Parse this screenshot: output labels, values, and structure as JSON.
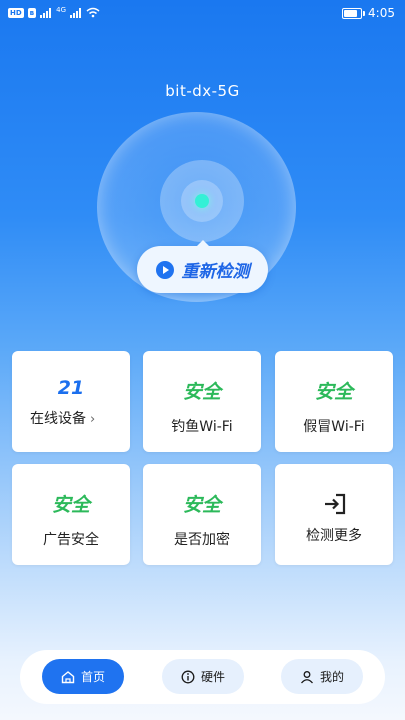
{
  "status_bar": {
    "hd_badge": "HD",
    "network": "4G",
    "time": "4:05"
  },
  "network": {
    "ssid": "bit-dx-5G",
    "recheck_label": "重新检测"
  },
  "cards": [
    {
      "value": "21",
      "label": "在线设备",
      "chevron": "›"
    },
    {
      "value": "安全",
      "label": "钓鱼Wi-Fi"
    },
    {
      "value": "安全",
      "label": "假冒Wi-Fi"
    },
    {
      "value": "安全",
      "label": "广告安全"
    },
    {
      "value": "安全",
      "label": "是否加密"
    },
    {
      "icon": "login-icon",
      "label": "检测更多"
    }
  ],
  "bottom_nav": {
    "home": "首页",
    "hardware": "硬件",
    "me": "我的"
  },
  "colors": {
    "primary": "#1f73f0",
    "safe": "#2cb95a",
    "accent_dot": "#34f0d6"
  }
}
